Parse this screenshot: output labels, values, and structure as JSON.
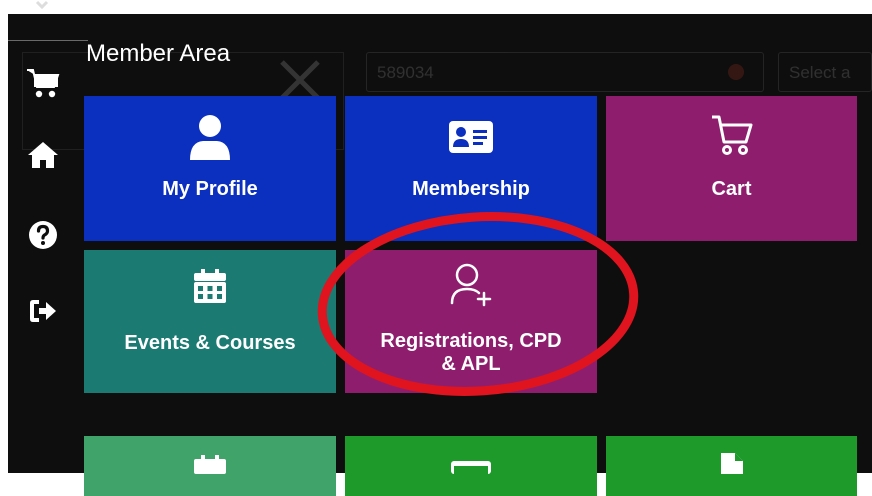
{
  "page": {
    "title": "Member Area",
    "background_input_value": "589034",
    "background_select_text": "Select a"
  },
  "sidebar": {
    "items": [
      {
        "icon": "cart-icon"
      },
      {
        "icon": "home-icon"
      },
      {
        "icon": "help-icon"
      },
      {
        "icon": "sign-out-icon"
      }
    ]
  },
  "tiles": [
    {
      "label": "My Profile",
      "icon": "user-icon",
      "color": "#0b2fbf"
    },
    {
      "label": "Membership",
      "icon": "id-card-icon",
      "color": "#0b2fbf"
    },
    {
      "label": "Cart",
      "icon": "cart-outline-icon",
      "color": "#8e1e6d"
    },
    {
      "label": "Events & Courses",
      "icon": "calendar-icon",
      "color": "#1b7a72"
    },
    {
      "label_line1": "Registrations, CPD",
      "label_line2": "& APL",
      "icon": "user-plus-icon",
      "color": "#8e1e6d"
    }
  ],
  "annotation": {
    "color": "#e0141e",
    "target": "Registrations, CPD & APL"
  },
  "colors": {
    "background": "#0e0e0e",
    "blue": "#0b2fbf",
    "purple": "#8e1e6d",
    "teal": "#1b7a72",
    "green": "#1e9a2a",
    "light_green": "#3fa36a"
  }
}
